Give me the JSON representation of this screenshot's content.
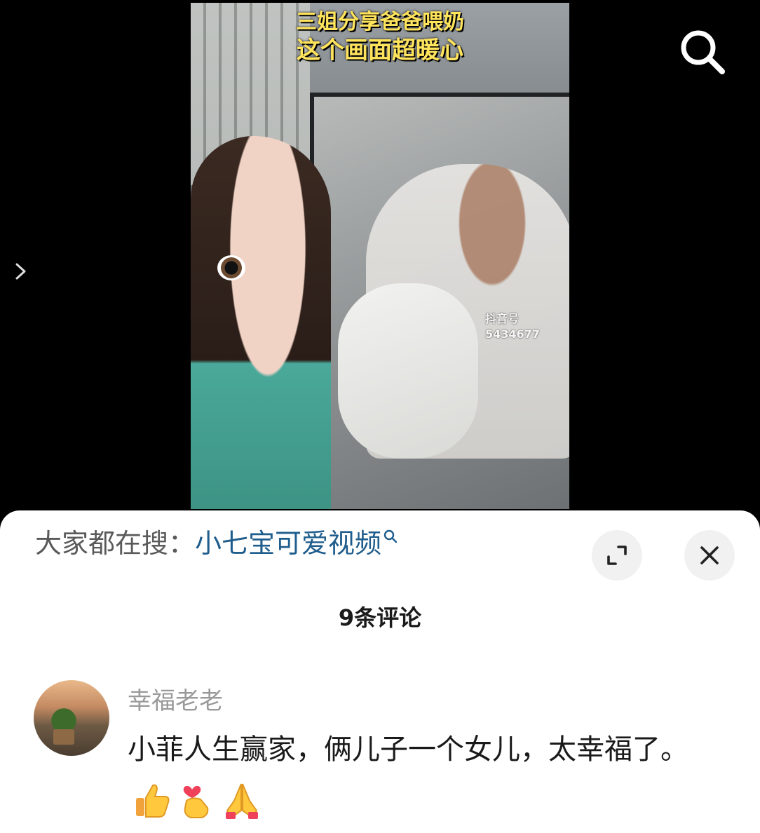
{
  "video": {
    "caption_line1": "三姐分享爸爸喂奶",
    "caption_line2": "这个画面超暖心",
    "watermark_line1": "抖音号",
    "watermark_line2": "5434677"
  },
  "icons": {
    "search": "search-icon",
    "side_arrow": "chevron-right-icon",
    "expand": "expand-icon",
    "close": "close-icon",
    "keyword_search": "search-small-icon"
  },
  "panel": {
    "search_prefix": "大家都在搜：",
    "search_keyword": "小七宝可爱视频",
    "comment_count": "9条评论"
  },
  "comments": [
    {
      "username": "幸福老老",
      "text": "小菲人生赢家，俩儿子一个女儿，太幸福了。",
      "emojis": [
        "thumbs-up-emoji",
        "finger-heart-emoji",
        "folded-hands-emoji"
      ]
    }
  ],
  "colors": {
    "keyword": "#1f5d8c",
    "caption": "#ffe45c",
    "username": "#9a9a9a"
  }
}
